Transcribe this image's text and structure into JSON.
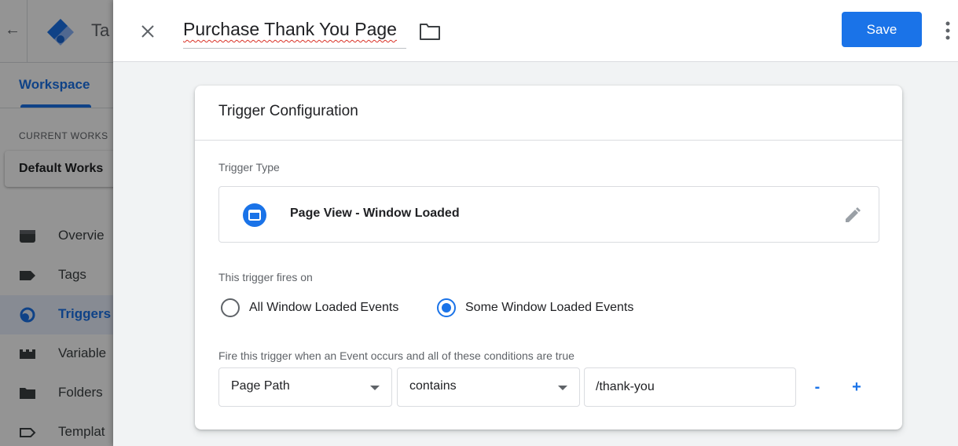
{
  "background": {
    "back_glyph": "←",
    "app_title": "Ta",
    "workspace_tab": "Workspace",
    "current_workspace_label": "CURRENT WORKS",
    "current_workspace_value": "Default Works",
    "nav_items": [
      {
        "label": "Overvie",
        "icon": "overview-icon"
      },
      {
        "label": "Tags",
        "icon": "tag-icon"
      },
      {
        "label": "Triggers",
        "icon": "trigger-icon",
        "active": true
      },
      {
        "label": "Variable",
        "icon": "variables-icon"
      },
      {
        "label": "Folders",
        "icon": "folder-icon"
      },
      {
        "label": "Templat",
        "icon": "template-icon"
      }
    ]
  },
  "header": {
    "title": "Purchase Thank You Page",
    "save_label": "Save"
  },
  "card": {
    "title": "Trigger Configuration",
    "trigger_type_label": "Trigger Type",
    "trigger_type_value": "Page View - Window Loaded",
    "fires_on_label": "This trigger fires on",
    "radio_all": "All Window Loaded Events",
    "radio_some": "Some Window Loaded Events",
    "selected_option": "Some Window Loaded Events",
    "condition_label": "Fire this trigger when an Event occurs and all of these conditions are true",
    "condition": {
      "variable": "Page Path",
      "operator": "contains",
      "value": "/thank-you"
    },
    "remove_label": "-",
    "add_label": "+"
  },
  "colors": {
    "accent": "#1a73e8",
    "text": "#202124",
    "muted": "#5f6368",
    "border": "#dadce0",
    "sheet_bg": "#f1f3f4"
  }
}
